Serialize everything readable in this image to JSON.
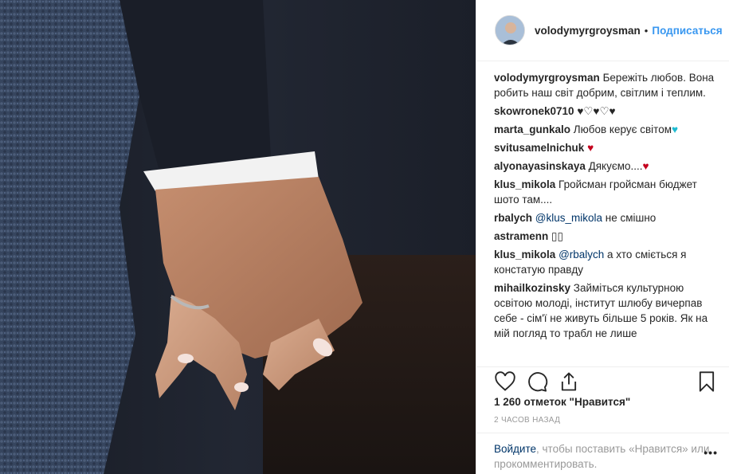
{
  "post": {
    "username": "volodymyrgroysman",
    "separator": "•",
    "follow_label": "Подписаться",
    "caption": "Бережіть любов. Вона робить наш світ добрим, світлим і теплим."
  },
  "comments": [
    {
      "user": "skowronek0710",
      "parts": [
        {
          "text": " ♥♡♥♡♥",
          "kind": "plain"
        }
      ]
    },
    {
      "user": "marta_gunkalo",
      "parts": [
        {
          "text": " Любов керує світом",
          "kind": "plain"
        },
        {
          "text": "♥",
          "kind": "heart-blue"
        }
      ]
    },
    {
      "user": "svitusamelnichuk",
      "parts": [
        {
          "text": " ",
          "kind": "plain"
        },
        {
          "text": "♥",
          "kind": "heart-red"
        }
      ]
    },
    {
      "user": "alyonayasinskaya",
      "parts": [
        {
          "text": " Дякуємо....",
          "kind": "plain"
        },
        {
          "text": "♥",
          "kind": "heart-red"
        }
      ]
    },
    {
      "user": "klus_mikola",
      "parts": [
        {
          "text": " Гройсман гройсман бюджет шото там....",
          "kind": "plain"
        }
      ]
    },
    {
      "user": "rbalych",
      "parts": [
        {
          "text": " ",
          "kind": "plain"
        },
        {
          "text": "@klus_mikola",
          "kind": "mention"
        },
        {
          "text": " не смішно",
          "kind": "plain"
        }
      ]
    },
    {
      "user": "astramenn",
      "parts": [
        {
          "text": " ▯▯",
          "kind": "plain"
        }
      ]
    },
    {
      "user": "klus_mikola",
      "parts": [
        {
          "text": " ",
          "kind": "plain"
        },
        {
          "text": "@rbalych",
          "kind": "mention"
        },
        {
          "text": " а хто сміється я констатую правду",
          "kind": "plain"
        }
      ]
    },
    {
      "user": "mihailkozinsky",
      "parts": [
        {
          "text": " Займіться культурною освітою молоді, інститут шлюбу вичерпав себе - сім'ї не живуть більше 5 років. Як на мій погляд то трабл не лише",
          "kind": "plain"
        }
      ]
    }
  ],
  "icons": {
    "like": "heart-outline-icon",
    "comment": "speech-bubble-icon",
    "share": "share-icon",
    "save": "bookmark-icon",
    "more": "more-dots-icon"
  },
  "likes": "1 260 отметок \"Нравится\"",
  "time_ago": "2 часов назад",
  "login": {
    "link": "Войдите",
    "rest": ", чтобы поставить «Нравится» или прокомментировать."
  },
  "more_label": "•••"
}
